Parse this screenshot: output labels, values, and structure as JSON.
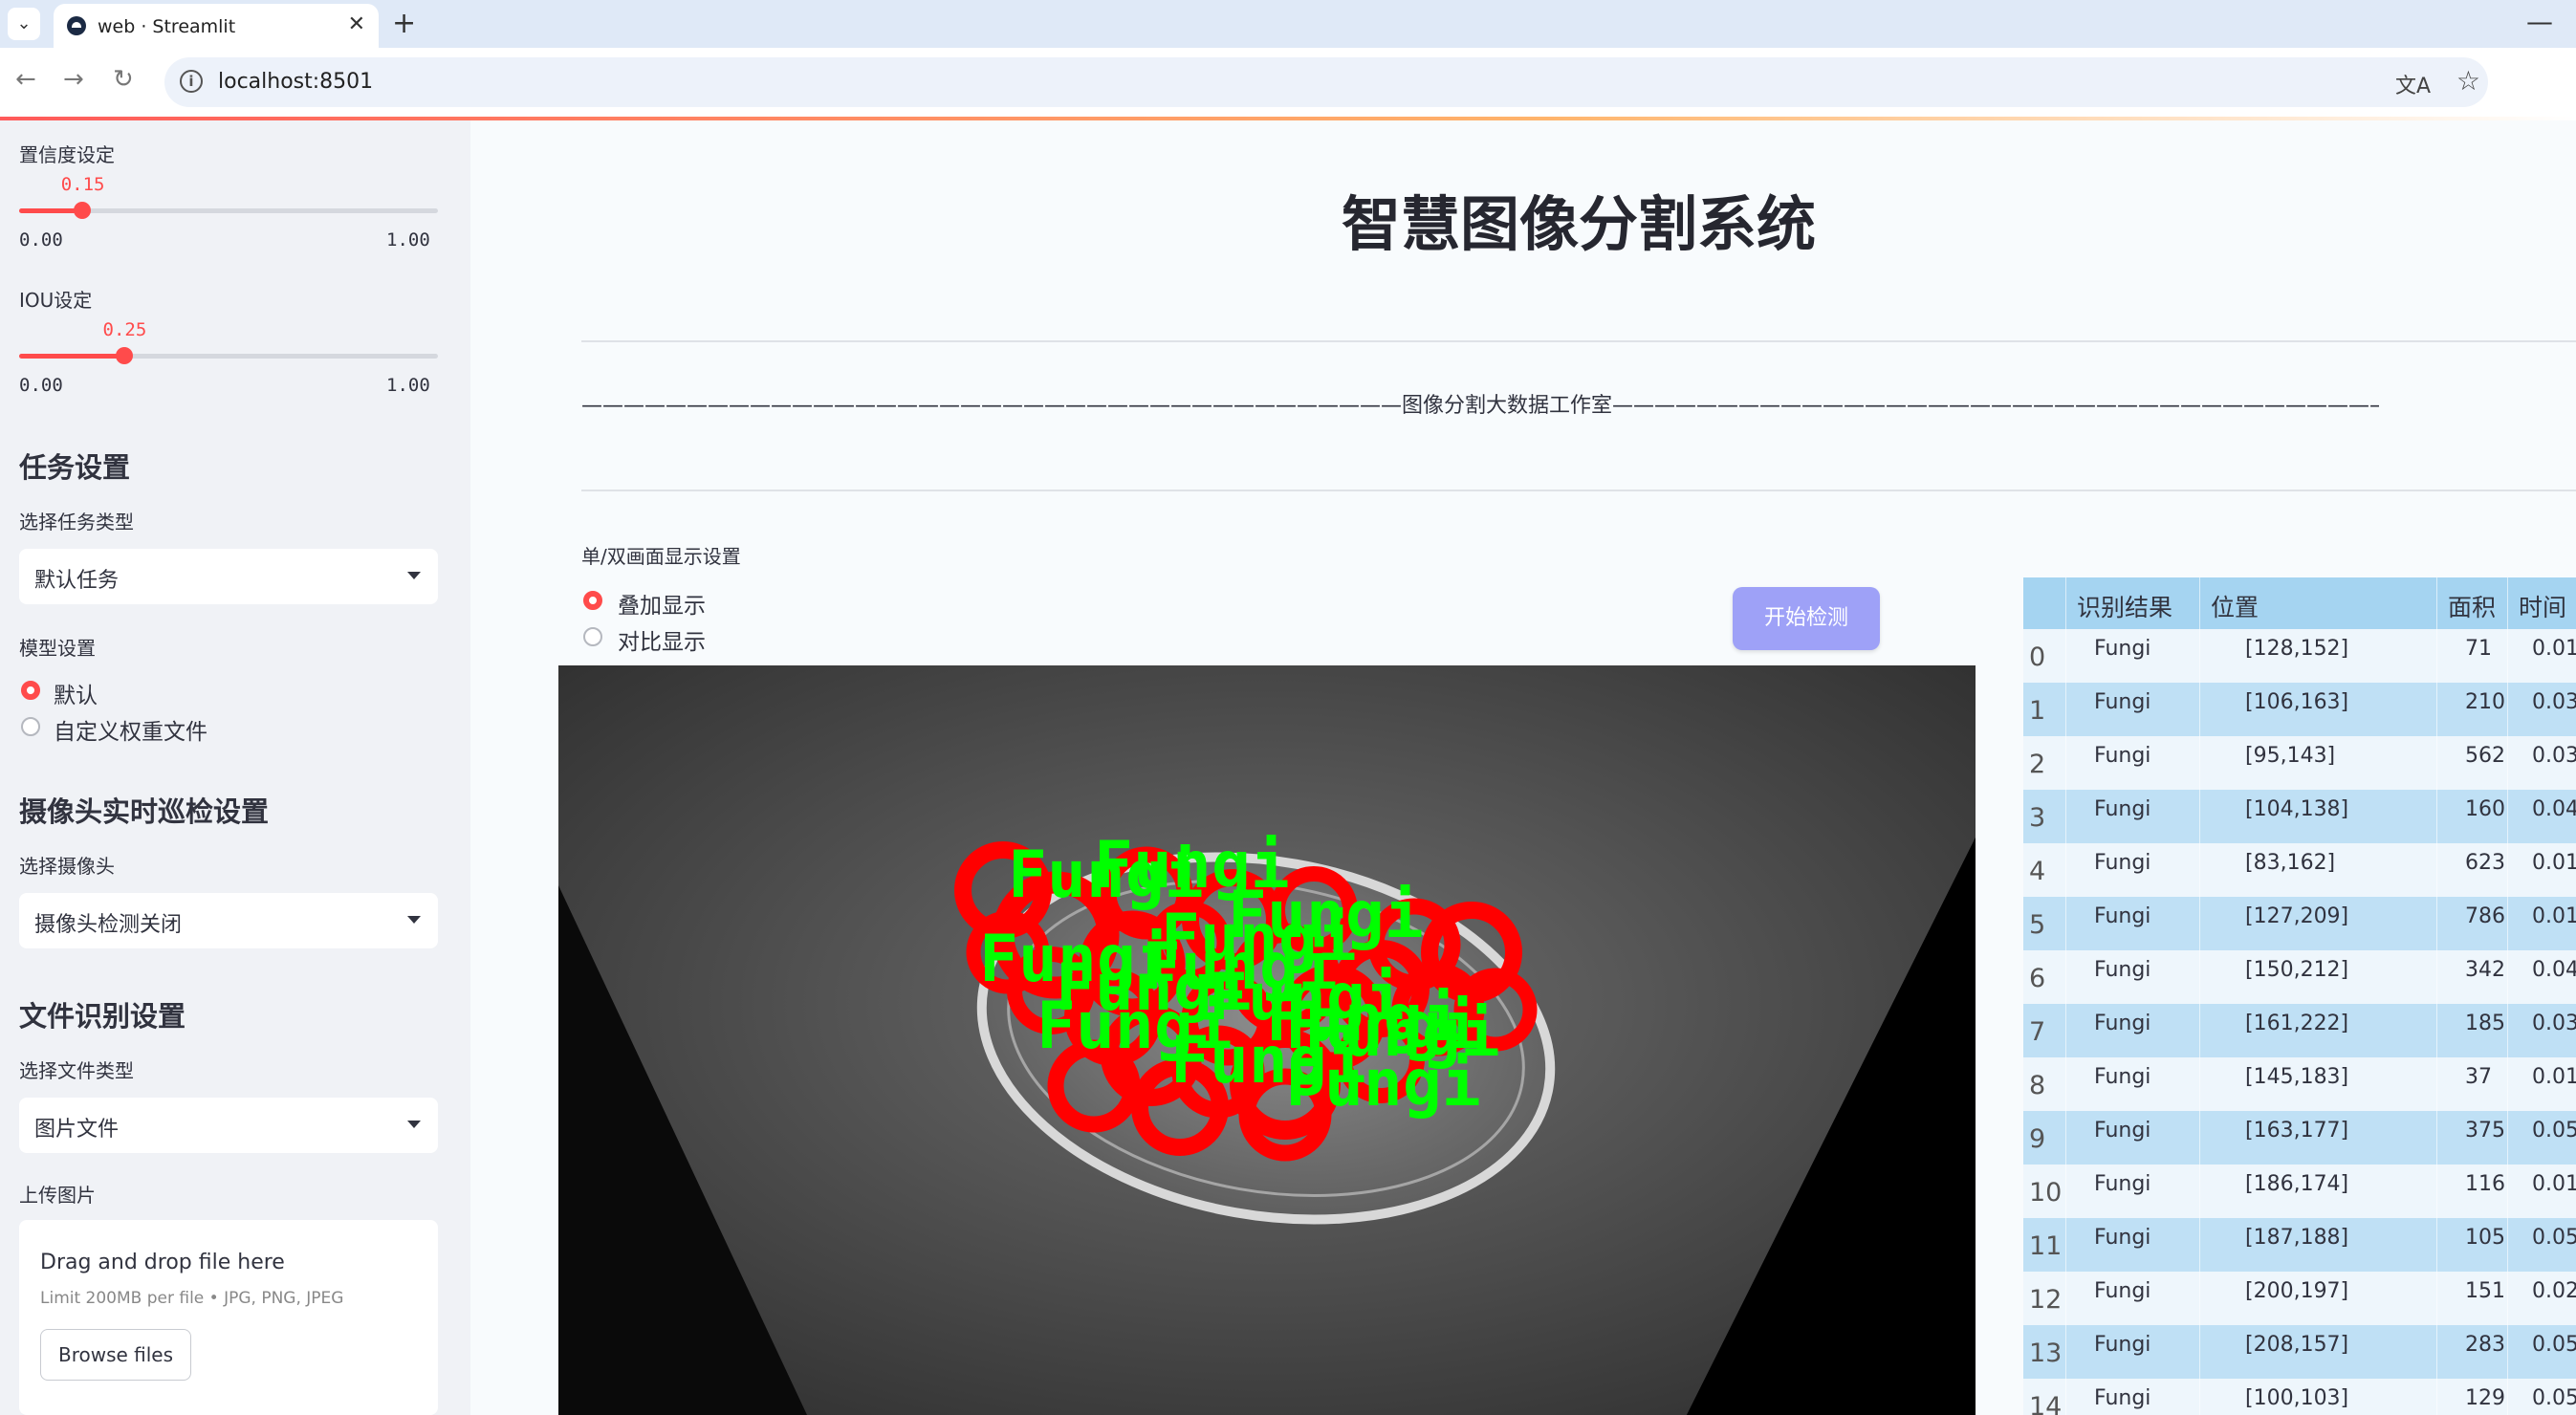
{
  "browser": {
    "tab_title": "web · Streamlit",
    "url": "localhost:8501"
  },
  "sidebar": {
    "confidence": {
      "label": "置信度设定",
      "value": "0.15",
      "min": "0.00",
      "max": "1.00",
      "fraction": 0.15
    },
    "iou": {
      "label": "IOU设定",
      "value": "0.25",
      "min": "0.00",
      "max": "1.00",
      "fraction": 0.25
    },
    "task_header": "任务设置",
    "task_type_label": "选择任务类型",
    "task_type_value": "默认任务",
    "model_label": "模型设置",
    "model_options": [
      "默认",
      "自定义权重文件"
    ],
    "model_selected": 0,
    "camera_header": "摄像头实时巡检设置",
    "camera_label": "选择摄像头",
    "camera_value": "摄像头检测关闭",
    "file_header": "文件识别设置",
    "file_type_label": "选择文件类型",
    "file_type_value": "图片文件",
    "upload_label": "上传图片",
    "upload_title": "Drag and drop file here",
    "upload_limit": "Limit 200MB per file • JPG, PNG, JPEG",
    "browse_label": "Browse files"
  },
  "main": {
    "title": "智慧图像分割系统",
    "studio_line": "———————————————————————————————————————图像分割大数据工作室———————————————————————————————————————",
    "display_label": "单/双画面显示设置",
    "display_options": [
      "叠加显示",
      "对比显示"
    ],
    "display_selected": 0,
    "start_button": "开始检测",
    "detection_label": "Fungi"
  },
  "table": {
    "headers": [
      "识别结果",
      "位置",
      "面积",
      "时间"
    ],
    "rows": [
      {
        "idx": "0",
        "result": "Fungi",
        "pos": "[128,152]",
        "area": "71",
        "time": "0.01"
      },
      {
        "idx": "1",
        "result": "Fungi",
        "pos": "[106,163]",
        "area": "210",
        "time": "0.03"
      },
      {
        "idx": "2",
        "result": "Fungi",
        "pos": "[95,143]",
        "area": "562",
        "time": "0.03"
      },
      {
        "idx": "3",
        "result": "Fungi",
        "pos": "[104,138]",
        "area": "160",
        "time": "0.04"
      },
      {
        "idx": "4",
        "result": "Fungi",
        "pos": "[83,162]",
        "area": "623",
        "time": "0.01"
      },
      {
        "idx": "5",
        "result": "Fungi",
        "pos": "[127,209]",
        "area": "786",
        "time": "0.01"
      },
      {
        "idx": "6",
        "result": "Fungi",
        "pos": "[150,212]",
        "area": "342",
        "time": "0.04"
      },
      {
        "idx": "7",
        "result": "Fungi",
        "pos": "[161,222]",
        "area": "185",
        "time": "0.03"
      },
      {
        "idx": "8",
        "result": "Fungi",
        "pos": "[145,183]",
        "area": "37",
        "time": "0.01"
      },
      {
        "idx": "9",
        "result": "Fungi",
        "pos": "[163,177]",
        "area": "375",
        "time": "0.05"
      },
      {
        "idx": "10",
        "result": "Fungi",
        "pos": "[186,174]",
        "area": "116",
        "time": "0.01"
      },
      {
        "idx": "11",
        "result": "Fungi",
        "pos": "[187,188]",
        "area": "105",
        "time": "0.05"
      },
      {
        "idx": "12",
        "result": "Fungi",
        "pos": "[200,197]",
        "area": "151",
        "time": "0.02"
      },
      {
        "idx": "13",
        "result": "Fungi",
        "pos": "[208,157]",
        "area": "283",
        "time": "0.05"
      },
      {
        "idx": "14",
        "result": "Fungi",
        "pos": "[100,103]",
        "area": "129",
        "time": "0.05"
      }
    ]
  },
  "colors": {
    "accent": "#ff4b4b",
    "button": "#9ea1f7",
    "table_header": "#a5d4f1",
    "mask": "#ff0000",
    "label": "#00ff00"
  }
}
